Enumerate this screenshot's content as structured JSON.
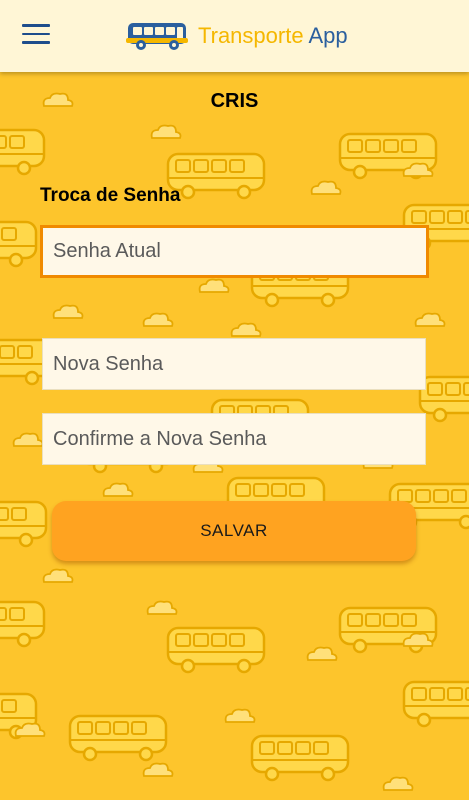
{
  "header": {
    "logo_word_1": "Transporte",
    "logo_word_2": "App"
  },
  "user": {
    "name": "CRIS"
  },
  "form": {
    "title": "Troca de Senha",
    "current_password_placeholder": "Senha Atual",
    "new_password_placeholder": "Nova Senha",
    "confirm_password_placeholder": "Confirme a Nova Senha",
    "save_label": "SALVAR"
  },
  "colors": {
    "background": "#fdc52c",
    "header": "#fff6d6",
    "accent_orange": "#ffa320",
    "focus_border": "#f08a00",
    "brand_blue": "#2b5f9e",
    "brand_yellow": "#f5b700"
  },
  "icons": [
    "menu-icon",
    "bus-logo-icon"
  ]
}
